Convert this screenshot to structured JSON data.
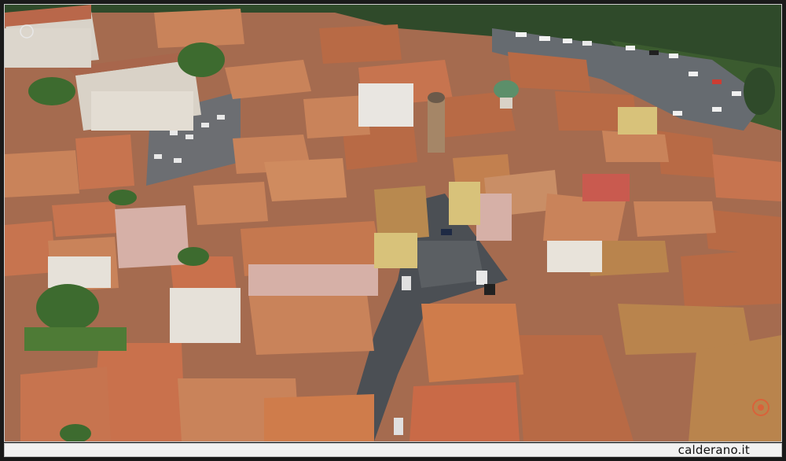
{
  "photo": {
    "description_kind": "aerial view of a dense hillside town with terracotta roofs",
    "colors": {
      "roof": "#b86a45",
      "roof_light": "#c9835a",
      "wall": "#d9d2c7",
      "wall_pink": "#d6b0a7",
      "wall_yellow": "#d8c27a",
      "street": "#4b4f54",
      "green": "#3d6b2f",
      "parking": "#6e6e6e",
      "dome": "#5c8f6a"
    }
  },
  "watermark": {
    "text": "calderano.it"
  }
}
